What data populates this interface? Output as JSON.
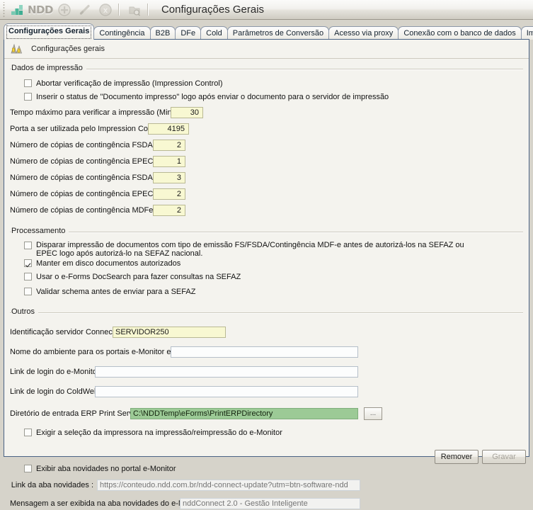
{
  "window": {
    "title": "Configurações Gerais"
  },
  "toolbar": {
    "logo_text": "NDD",
    "icons": [
      {
        "name": "add-icon",
        "label": "Adicionar"
      },
      {
        "name": "edit-pencil-icon",
        "label": "Editar"
      },
      {
        "name": "delete-circle-icon",
        "label": "Excluir"
      },
      {
        "name": "search-document-icon",
        "label": "Pesquisar"
      }
    ]
  },
  "tabs": [
    {
      "label": "Configurações Gerais",
      "active": true
    },
    {
      "label": "Contingência",
      "active": false
    },
    {
      "label": "B2B",
      "active": false
    },
    {
      "label": "DFe",
      "active": false
    },
    {
      "label": "Cold",
      "active": false
    },
    {
      "label": "Parâmetros de Conversão",
      "active": false
    },
    {
      "label": "Acesso via proxy",
      "active": false
    },
    {
      "label": "Conexão com o banco de dados",
      "active": false
    },
    {
      "label": "Impressão",
      "active": false
    }
  ],
  "page": {
    "header": "Configurações gerais"
  },
  "groups": {
    "dados_impressao": {
      "title": "Dados de impressão",
      "checkboxes": [
        {
          "label": "Abortar verificação de impressão (Impression Control)",
          "checked": false
        },
        {
          "label": "Inserir o status de \"Documento impresso\" logo após enviar o documento para o servidor de impressão",
          "checked": false
        }
      ],
      "fields": [
        {
          "label": "Tempo máximo para verificar a impressão (Minutos):",
          "value": "30"
        },
        {
          "label": "Porta a ser utilizada pelo Impression Control:",
          "value": "4195"
        },
        {
          "label": "Número de cópias de contingência FSDA NFe:",
          "value": "2"
        },
        {
          "label": "Número de cópias de contingência EPEC NFe:",
          "value": "1"
        },
        {
          "label": "Número de cópias de contingência FSDA CTe:",
          "value": "3"
        },
        {
          "label": "Número de cópias de contingência EPEC CTe:",
          "value": "2"
        },
        {
          "label": "Número de cópias de contingência MDFe:",
          "value": "2"
        }
      ]
    },
    "processamento": {
      "title": "Processamento",
      "checkboxes": [
        {
          "label": "Disparar impressão de documentos com tipo de emissão FS/FSDA/Contingência MDF-e antes de autorizá-los na SEFAZ ou EPEC logo após autorizá-lo na SEFAZ nacional.",
          "checked": false
        },
        {
          "label": "Manter em disco documentos autorizados",
          "checked": true
        },
        {
          "label": "Usar o e-Forms DocSearch para fazer consultas na SEFAZ",
          "checked": false
        },
        {
          "label": "Validar schema antes de enviar para a SEFAZ",
          "checked": false
        }
      ]
    },
    "outros": {
      "title": "Outros",
      "connector": {
        "label": "Identificação servidor Connector:",
        "value": "SERVIDOR250"
      },
      "ambiente": {
        "label": "Nome do ambiente para os portais e-Monitor e e-Cold:",
        "value": ""
      },
      "link_emonitor": {
        "label": "Link de login do e-Monitor:",
        "value": ""
      },
      "link_coldweb": {
        "label": "Link de login do ColdWeb:",
        "value": ""
      },
      "diretorio": {
        "label": "Diretório de entrada ERP Print Service:",
        "value": "C:\\NDDTemp\\eForms\\PrintERPDirectory",
        "browse_label": "..."
      },
      "exigir_impressora": {
        "label": "Exigir a seleção da impressora na impressão/reimpressão do e-Monitor",
        "checked": false
      },
      "exibir_novidades": {
        "label": "Exibir aba novidades no portal e-Monitor",
        "checked": false
      },
      "link_novidades": {
        "label": "Link da aba novidades :",
        "placeholder": "https://conteudo.ndd.com.br/ndd-connect-update?utm=btn-software-ndd",
        "value": ""
      },
      "mensagem_novidades": {
        "label": "Mensagem a ser exibida na aba novidades do e-Monitor:",
        "placeholder": "nddConnect 2.0 - Gestão Inteligente",
        "value": ""
      }
    }
  },
  "footer": {
    "remover_label": "Remover",
    "gravar_label": "Gravar"
  },
  "colors": {
    "accent_green": "#9cca96",
    "field_yellow": "#f8f8d2",
    "tab_border": "#4a6384",
    "logo_green": "#5fbfa1"
  }
}
